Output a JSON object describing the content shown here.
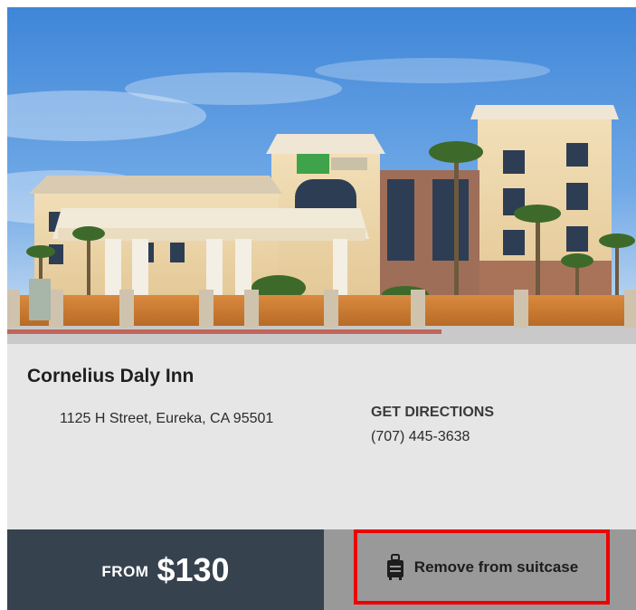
{
  "hotel": {
    "name": "Cornelius Daly Inn",
    "address": "1125 H Street, Eureka, CA 95501",
    "directions_label": "GET DIRECTIONS",
    "phone": "(707) 445-3638",
    "photo_icon": "hotel-photo"
  },
  "price": {
    "from_label": "FROM",
    "amount": "$130"
  },
  "suitcase": {
    "remove_label": "Remove from suitcase",
    "icon": "suitcase-icon"
  },
  "colors": {
    "price_bar": "#37424f",
    "info_bg": "#e6e6e6",
    "suitcase_bg": "#999999",
    "highlight": "#ee0000"
  }
}
